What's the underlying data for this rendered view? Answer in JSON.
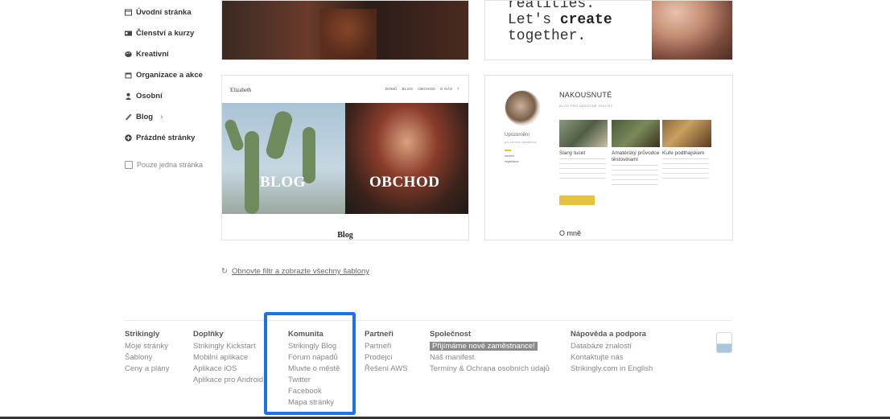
{
  "sidebar": {
    "items": [
      {
        "label": "Úvodní stránka",
        "icon": "window-icon"
      },
      {
        "label": "Členství a kurzy",
        "icon": "id-card-icon"
      },
      {
        "label": "Kreativní",
        "icon": "palette-icon"
      },
      {
        "label": "Organizace a akce",
        "icon": "calendar-icon"
      },
      {
        "label": "Osobní",
        "icon": "person-icon"
      },
      {
        "label": "Blog",
        "icon": "pen-icon"
      },
      {
        "label": "Prázdné stránky",
        "icon": "plus-circle-icon"
      }
    ],
    "single_page_label": "Pouze jedna stránka"
  },
  "cards": {
    "top_right_text_line1": "realities.",
    "top_right_text_line2_prefix": "Let's ",
    "top_right_text_line2_bold": "create",
    "top_right_text_line3": "together.",
    "bottom_left": {
      "brand": "Elizabeth",
      "nav": [
        "DOMŮ",
        "BLOG",
        "OBCHOD",
        "O NÁS"
      ],
      "left_label": "BLOG",
      "right_label": "OBCHOD",
      "footer_title": "Blog"
    },
    "bottom_right": {
      "title": "NAKOUSNUTÉ",
      "subtitle": "BLOG PRO NÁROČNÉ JEDLÍKY",
      "notice": "Upozornění",
      "notice_sub": "pro serveru aktuálnost",
      "side_line1": "osobní",
      "side_line2": "registrace",
      "posts": [
        {
          "title": "Slaný tucet"
        },
        {
          "title": "Amatérský průvodce těstovinami"
        },
        {
          "title": "Kuře podthajskem"
        }
      ],
      "about": "O mně"
    }
  },
  "refresh_link": "Obnovte filtr a zobrazte všechny šablony",
  "footer": {
    "columns": [
      {
        "heading": "Strikingly",
        "links": [
          "Moje stránky",
          "Šablony",
          "Ceny a plány"
        ]
      },
      {
        "heading": "Doplňky",
        "links": [
          "Strikingly Kickstart",
          "Mobilní aplikace",
          "Aplikace iOS",
          "Aplikace pro Android"
        ]
      },
      {
        "heading": "Komunita",
        "links": [
          "Strikingly Blog",
          "Fórum nápadů",
          "Mluvte o městě",
          "Twitter",
          "Facebook",
          "Mapa stránky"
        ]
      },
      {
        "heading": "Partneři",
        "links": [
          "Partneři",
          "Prodejci",
          "Řešení AWS"
        ]
      },
      {
        "heading": "Společnost",
        "links": [
          "Přijímáme nové zaměstnance!",
          "Náš manifest",
          "Termíny & Ochrana osobních údajů"
        ]
      },
      {
        "heading": "Nápověda a podpora",
        "links": [
          "Databáze znalostí",
          "Kontaktujte nás",
          "Strikingly.com in English"
        ]
      }
    ]
  },
  "colors": {
    "highlight": "#1a73e8",
    "button_yellow": "#e9c23c"
  }
}
